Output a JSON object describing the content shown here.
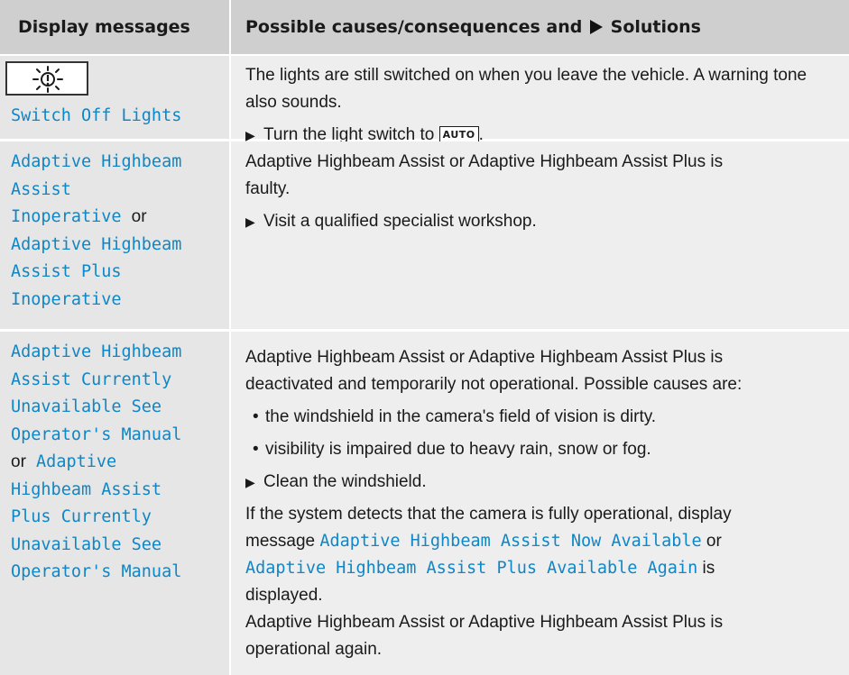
{
  "header": {
    "col_left": "Display messages",
    "col_right_prefix": "Possible causes/consequences and",
    "col_right_suffix": "Solutions"
  },
  "rows": [
    {
      "icon": "lights-on-warning-icon",
      "message": "Switch Off Lights",
      "cause": "The lights are still switched on when you leave the vehicle. A warning tone also sounds.",
      "step_prefix": "Turn the light switch to",
      "step_key": "AUTO",
      "step_suffix": "."
    },
    {
      "message_1_lines": [
        "Adaptive Highbeam",
        "Assist",
        "Inoperative"
      ],
      "conj": "or",
      "message_2_lines": [
        "Adaptive Highbeam",
        "Assist Plus",
        "Inoperative"
      ],
      "cause_lines": [
        "Adaptive Highbeam Assist or Adaptive Highbeam Assist Plus is",
        "faulty."
      ],
      "step": "Visit a qualified specialist workshop."
    },
    {
      "message_1_lines": [
        "Adaptive Highbeam",
        "Assist Currently",
        "Unavailable See",
        "Operator's Manual"
      ],
      "conj": "or",
      "message_2_first": "Adaptive",
      "message_2_lines": [
        "Highbeam Assist",
        "Plus Currently",
        "Unavailable See",
        "Operator's Manual"
      ],
      "cause_lines": [
        "Adaptive Highbeam Assist or Adaptive Highbeam Assist Plus is",
        "deactivated and temporarily not operational. Possible causes are:"
      ],
      "bullets": [
        "the windshield in the camera's field of vision is dirty.",
        "visibility is impaired due to heavy rain, snow or fog."
      ],
      "step": "Clean the windshield.",
      "detect_line1": "If the system detects that the camera is fully operational, display",
      "detect_prefix": "message",
      "detect_msg_1": "Adaptive Highbeam Assist Now Available",
      "detect_or": "or",
      "detect_msg_2": "Adaptive Highbeam Assist Plus Available Again",
      "detect_is": "is",
      "detect_end": "displayed.",
      "final_lines": [
        "Adaptive Highbeam Assist or Adaptive Highbeam Assist Plus is",
        "operational again."
      ]
    }
  ],
  "colors": {
    "header_bg": "#cfcfcf",
    "left_cell_bg": "#e6e6e6",
    "right_cell_bg": "#eeeeee",
    "message_text": "#0f86c6"
  }
}
